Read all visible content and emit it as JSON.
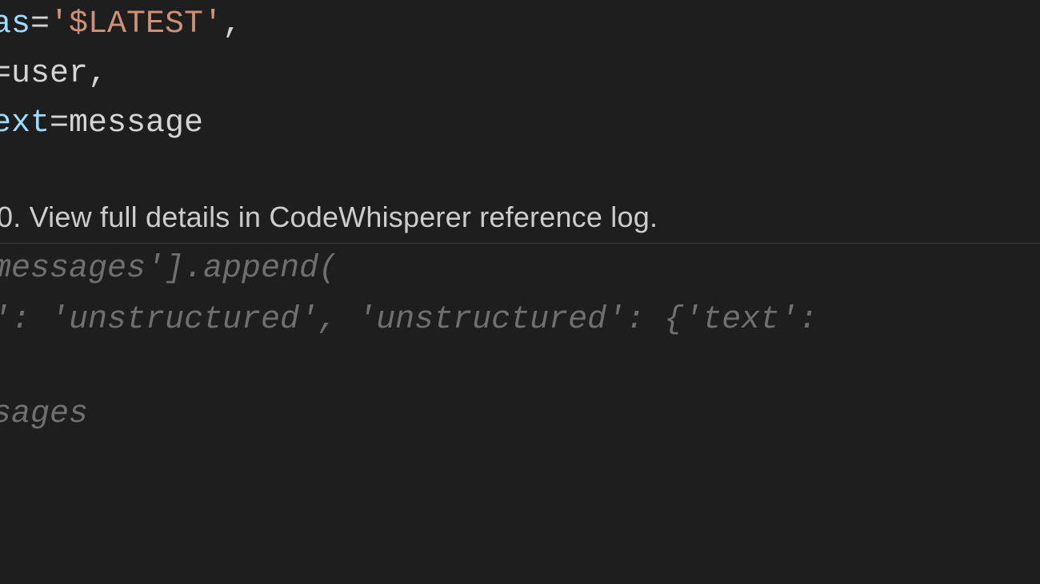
{
  "code": {
    "line1_pre": "as",
    "line1_op": "=",
    "line1_str": "'$LATEST'",
    "line1_post": ",",
    "line2_pre": "",
    "line2_op": "=",
    "line2_ident": "user",
    "line2_post": ",",
    "line3_param": "ext",
    "line3_op": "=",
    "line3_ident": "message"
  },
  "hint": {
    "text": "0. View full details in CodeWhisperer reference log."
  },
  "suggestion": {
    "g1": "messages'].append(",
    "g2": "': 'unstructured', 'unstructured': {'text':",
    "g3": "sages"
  }
}
